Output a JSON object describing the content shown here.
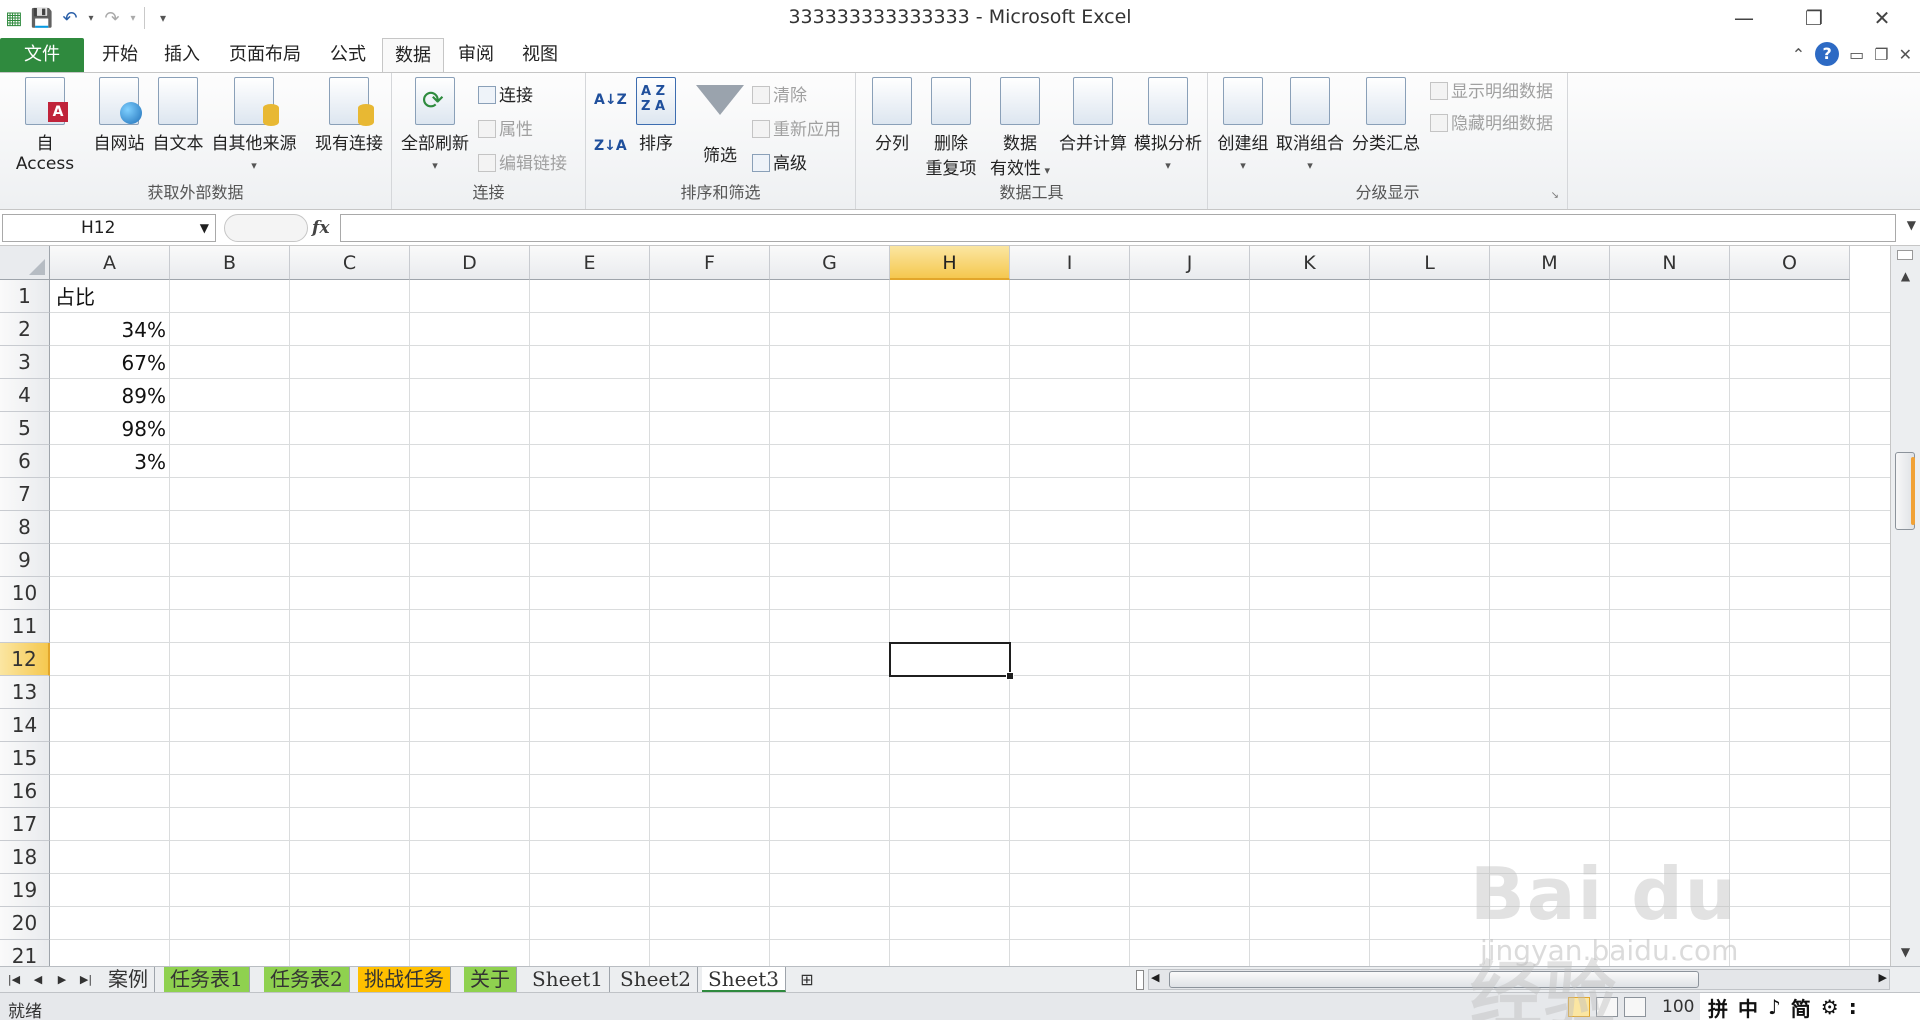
{
  "window": {
    "title": "333333333333333 - Microsoft Excel"
  },
  "colors": {
    "file_tab": "#2f8a3e",
    "selected_header": "#f5c84f",
    "green_tab": "#8fd14f",
    "orange_tab": "#ffc000"
  },
  "tabs": [
    "文件",
    "开始",
    "插入",
    "页面布局",
    "公式",
    "数据",
    "审阅",
    "视图"
  ],
  "active_tab": "数据",
  "ribbon": {
    "groups": {
      "external": "获取外部数据",
      "connections": "连接",
      "sort_filter": "排序和筛选",
      "data_tools": "数据工具",
      "outline": "分级显示"
    },
    "buttons": {
      "from_access": "自 Access",
      "from_web": "自网站",
      "from_text": "自文本",
      "from_other": "自其他来源",
      "existing": "现有连接",
      "refresh_all": "全部刷新",
      "connections": "连接",
      "properties": "属性",
      "edit_links": "编辑链接",
      "sort": "排序",
      "filter": "筛选",
      "clear": "清除",
      "reapply": "重新应用",
      "advanced": "高级",
      "text_to_columns": "分列",
      "remove_dup_1": "删除",
      "remove_dup_2": "重复项",
      "validation_1": "数据",
      "validation_2": "有效性",
      "consolidate": "合并计算",
      "whatif": "模拟分析",
      "group": "创建组",
      "ungroup": "取消组合",
      "subtotal": "分类汇总",
      "show_detail": "显示明细数据",
      "hide_detail": "隐藏明细数据"
    }
  },
  "formula_bar": {
    "name_box": "H12",
    "fx": "fx",
    "value": ""
  },
  "grid": {
    "columns": [
      "A",
      "B",
      "C",
      "D",
      "E",
      "F",
      "G",
      "H",
      "I",
      "J",
      "K",
      "L",
      "M",
      "N",
      "O"
    ],
    "rows": [
      "1",
      "2",
      "3",
      "4",
      "5",
      "6",
      "7",
      "8",
      "9",
      "10",
      "11",
      "12",
      "13",
      "14",
      "15",
      "16",
      "17",
      "18",
      "19",
      "20",
      "21"
    ],
    "selected_cell": "H12",
    "cells": {
      "A1": "占比",
      "A2": "34%",
      "A3": "67%",
      "A4": "89%",
      "A5": "98%",
      "A6": "3%"
    }
  },
  "sheets": [
    {
      "name": "案例",
      "color": "none"
    },
    {
      "name": "任务表1",
      "color": "green"
    },
    {
      "name": "任务表2",
      "color": "green"
    },
    {
      "name": "挑战任务",
      "color": "orange"
    },
    {
      "name": "关于",
      "color": "green"
    },
    {
      "name": "Sheet1",
      "color": "none"
    },
    {
      "name": "Sheet2",
      "color": "none"
    },
    {
      "name": "Sheet3",
      "color": "active"
    }
  ],
  "status": {
    "ready": "就绪",
    "zoom": "100",
    "ime": [
      "拼",
      "中",
      "♪",
      "简",
      "⚙",
      ":"
    ]
  },
  "watermark": {
    "logo": "Bai du 经验",
    "url": "jingyan.baidu.com"
  }
}
